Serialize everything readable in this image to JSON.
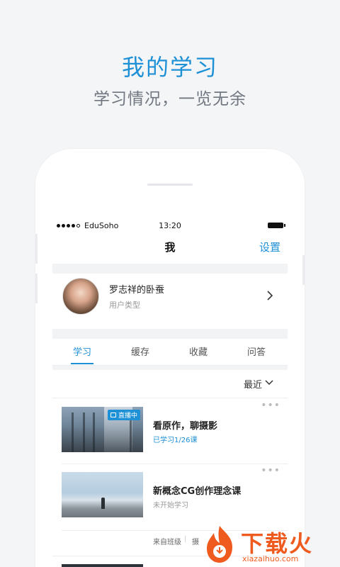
{
  "promo": {
    "headline": "我的学习",
    "subheadline": "学习情况，一览无余"
  },
  "status_bar": {
    "carrier": "EduSoho",
    "time": "13:20"
  },
  "nav": {
    "title": "我",
    "settings_label": "设置"
  },
  "profile": {
    "username": "罗志祥的卧蚕",
    "user_type": "用户类型"
  },
  "tabs": [
    {
      "label": "学习",
      "active": true
    },
    {
      "label": "缓存",
      "active": false
    },
    {
      "label": "收藏",
      "active": false
    },
    {
      "label": "问答",
      "active": false
    }
  ],
  "sort": {
    "label": "最近"
  },
  "courses": [
    {
      "title": "看原作，聊摄影",
      "status": "已学习1/26课",
      "badge": "直播中",
      "more": "•••"
    },
    {
      "title": "新概念CG创作理念课",
      "status": "未开始学习",
      "more": "•••"
    }
  ],
  "source": {
    "label": "来自班级",
    "separator": "|",
    "extra": "摄"
  },
  "watermark": {
    "text": "下载火",
    "url": "xiazaihuo.com"
  },
  "colors": {
    "accent": "#1e90d6",
    "watermark": "#ef5b1f"
  }
}
